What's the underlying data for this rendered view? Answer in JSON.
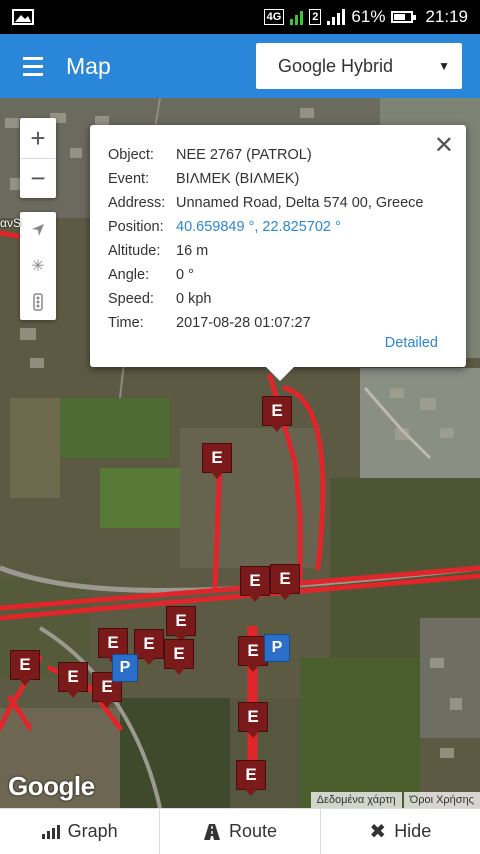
{
  "statusbar": {
    "network": "4G",
    "sim2": "2",
    "battery": "61%",
    "time": "21:19"
  },
  "appbar": {
    "title": "Map",
    "map_type": "Google Hybrid"
  },
  "map": {
    "zoom_in": "+",
    "zoom_out": "−",
    "side_label": "ανS",
    "google_logo": "Google",
    "attribution": [
      "Δεδομένα χάρτη",
      "Όροι Χρήσης"
    ]
  },
  "popup": {
    "rows": [
      {
        "key": "Object:",
        "value": "ΝΕΕ 2767 (PATROL)"
      },
      {
        "key": "Event:",
        "value": "ΒΙΛΜΕΚ (ΒΙΛΜΕΚ)"
      },
      {
        "key": "Address:",
        "value": "Unnamed Road, Delta 574 00, Greece"
      },
      {
        "key": "Position:",
        "value": "40.659849 °, 22.825702 °"
      },
      {
        "key": "Altitude:",
        "value": "16 m"
      },
      {
        "key": "Angle:",
        "value": "0 °"
      },
      {
        "key": "Speed:",
        "value": "0 kph"
      },
      {
        "key": "Time:",
        "value": "2017-08-28 01:07:27"
      }
    ],
    "detailed": "Detailed",
    "close": "✕"
  },
  "markers": {
    "event_letter": "E",
    "parking_letter": "P"
  },
  "bottom": {
    "graph": "Graph",
    "route": "Route",
    "hide": "Hide"
  }
}
